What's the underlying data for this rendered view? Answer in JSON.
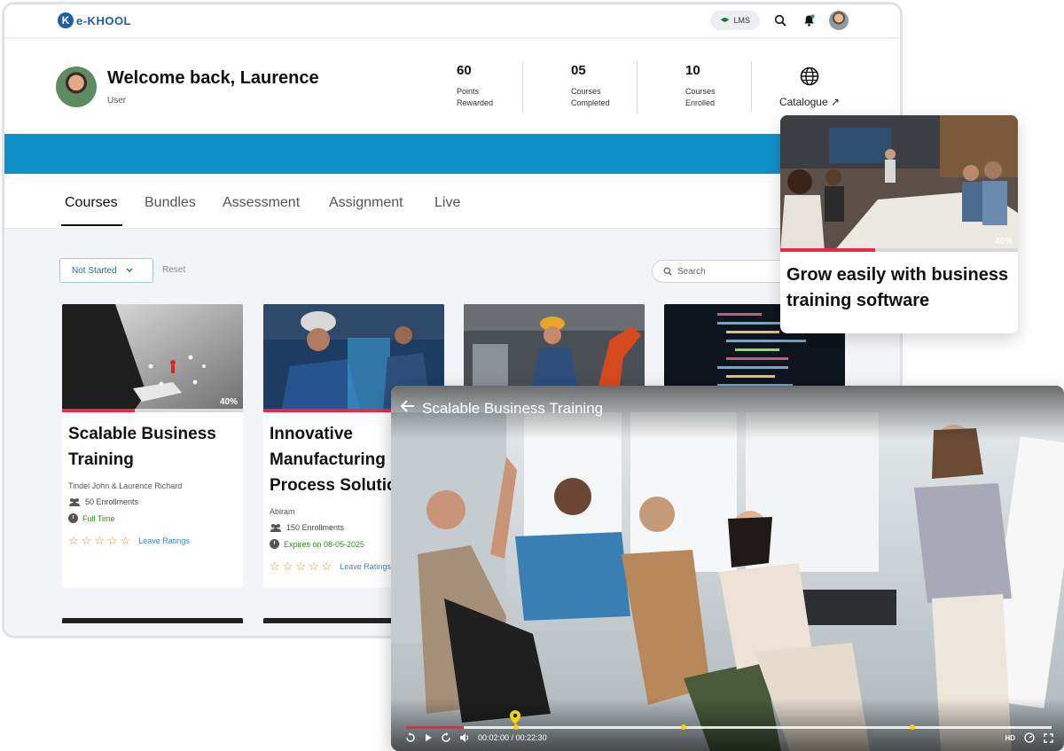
{
  "app": {
    "logo_text": "e-KHOOL",
    "logo_letter": "K"
  },
  "topbar": {
    "lms_label": "LMS",
    "icons": [
      "graduation-cap-icon",
      "search-icon",
      "bell-icon",
      "avatar"
    ]
  },
  "profile": {
    "welcome": "Welcome back, Laurence",
    "role": "User",
    "stats": [
      {
        "value": "60",
        "label": "Points Rewarded"
      },
      {
        "value": "05",
        "label": "Courses Completed"
      },
      {
        "value": "10",
        "label": "Courses Enrolled"
      }
    ],
    "catalogue_label": "Catalogue ↗"
  },
  "tabs": [
    {
      "label": "Courses",
      "active": true
    },
    {
      "label": "Bundles",
      "active": false
    },
    {
      "label": "Assessment",
      "active": false
    },
    {
      "label": "Assignment",
      "active": false
    },
    {
      "label": "Live",
      "active": false
    }
  ],
  "filters": {
    "status": "Not Started",
    "reset": "Reset",
    "search_placeholder": "Search"
  },
  "courses": [
    {
      "title": "Scalable Business\nTraining",
      "author": "Tindel John & Laurence Richard",
      "enrollments": "50 Enrollments",
      "status": "Full Time",
      "rating_label": "Leave Ratings",
      "progress_pct": 40,
      "progress_text": "40%"
    },
    {
      "title": "Innovative\nManufacturing\nProcess Solutions",
      "author": "Abiram",
      "enrollments": "150 Enrollments",
      "status": "Expires on 08-05-2025",
      "rating_label": "Leave Ratings",
      "progress_pct": 100,
      "progress_text": ""
    }
  ],
  "featured": {
    "title": "Grow easily with business training software",
    "progress_pct": 40,
    "progress_text": "40%"
  },
  "player": {
    "title": "Scalable Business Training",
    "current_time": "00:02:00",
    "duration": "00:22:30",
    "time_separator": "/",
    "progress_fraction": 0.089,
    "markers": [
      0.17,
      0.43,
      0.785
    ],
    "quality_label": "HD"
  },
  "colors": {
    "brand": "#1c5fa8",
    "band": "#0e90c9",
    "progress": "#e8294a",
    "marker": "#f5d20b"
  }
}
